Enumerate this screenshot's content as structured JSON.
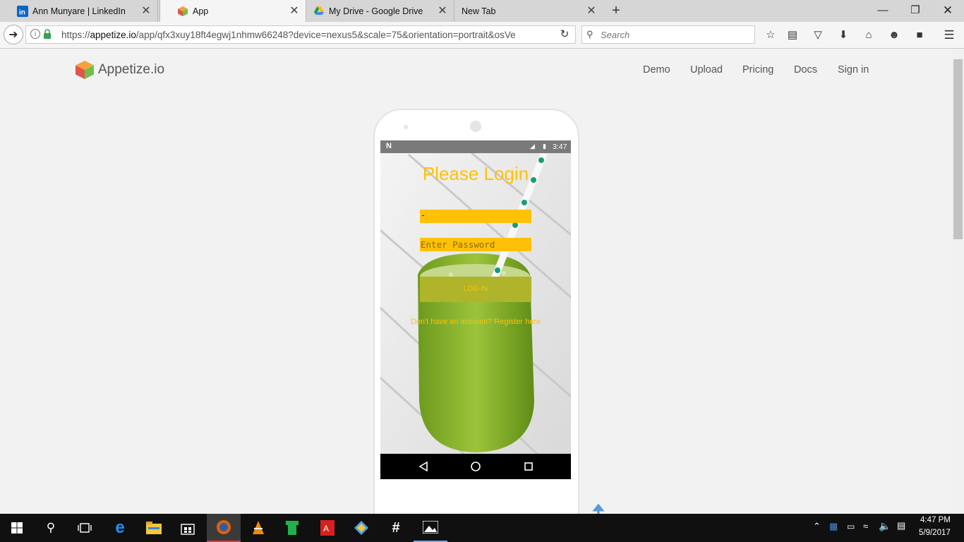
{
  "browser": {
    "tabs": [
      {
        "title": "Ann Munyare | LinkedIn",
        "icon": "linkedin-icon"
      },
      {
        "title": "App",
        "icon": "appetize-cube-icon"
      },
      {
        "title": "My Drive - Google Drive",
        "icon": "google-drive-icon"
      },
      {
        "title": "New Tab",
        "icon": ""
      }
    ],
    "active_tab": 1,
    "url_prefix": "https://",
    "url_host": "appetize.io",
    "url_path": "/app/qfx3xuy18ft4egwj1nhmw66248?device=nexus5&scale=75&orientation=portrait&osVe",
    "search_placeholder": "Search"
  },
  "site": {
    "brand": "Appetize.io",
    "nav": [
      "Demo",
      "Upload",
      "Pricing",
      "Docs",
      "Sign in"
    ]
  },
  "app": {
    "status_time": "3:47",
    "title": "Please Login",
    "username_value": "-",
    "password_placeholder": "Enter Password",
    "login_label": "LOG-IN",
    "register_text": "Don't have an account? Register here",
    "accent_color": "#ffc107",
    "button_color": "#afb42b"
  },
  "taskbar": {
    "time": "4:47 PM",
    "date": "5/9/2017"
  }
}
